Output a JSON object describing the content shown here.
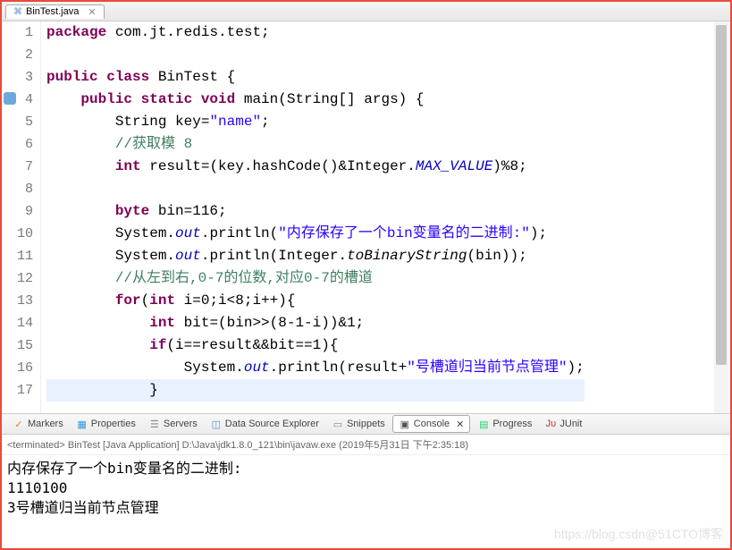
{
  "tab": {
    "label": "BinTest.java"
  },
  "lines": [
    {
      "n": "1",
      "html": "<span class='kw'>package</span> com.jt.redis.test;"
    },
    {
      "n": "2",
      "html": ""
    },
    {
      "n": "3",
      "html": "<span class='kw'>public class</span> BinTest {"
    },
    {
      "n": "4",
      "exec": true,
      "html": "    <span class='kw'>public static void</span> main(String[] args) {"
    },
    {
      "n": "5",
      "html": "        String key=<span class='str'>\"name\"</span>;"
    },
    {
      "n": "6",
      "html": "        <span class='cm'>//获取模 8</span>"
    },
    {
      "n": "7",
      "html": "        <span class='kw'>int</span> result=(key.hashCode()&Integer.<span class='fld'>MAX_VALUE</span>)%8;"
    },
    {
      "n": "8",
      "html": ""
    },
    {
      "n": "9",
      "html": "        <span class='kw'>byte</span> bin=116;"
    },
    {
      "n": "10",
      "html": "        System.<span class='fld'>out</span>.println(<span class='str'>\"内存保存了一个bin变量名的二进制:\"</span>);"
    },
    {
      "n": "11",
      "html": "        System.<span class='fld'>out</span>.println(Integer.<span class='mtd'>toBinaryString</span>(bin));"
    },
    {
      "n": "12",
      "html": "        <span class='cm'>//从左到右,0-7的位数,对应0-7的槽道</span>"
    },
    {
      "n": "13",
      "html": "        <span class='kw'>for</span>(<span class='kw'>int</span> i=0;i&lt;8;i++){"
    },
    {
      "n": "14",
      "html": "            <span class='kw'>int</span> bit=(bin&gt;&gt;(8-1-i))&amp;1;"
    },
    {
      "n": "15",
      "html": "            <span class='kw'>if</span>(i==result&amp;&amp;bit==1){"
    },
    {
      "n": "16",
      "html": "                System.<span class='fld'>out</span>.println(result+<span class='str'>\"号槽道归当前节点管理\"</span>);"
    },
    {
      "n": "17",
      "html": "            }",
      "highlight": true
    }
  ],
  "bottom_tabs": [
    {
      "label": "Markers",
      "icon": "✓",
      "color": "#e67e22"
    },
    {
      "label": "Properties",
      "icon": "▦",
      "color": "#3498db"
    },
    {
      "label": "Servers",
      "icon": "☰",
      "color": "#888"
    },
    {
      "label": "Data Source Explorer",
      "icon": "◫",
      "color": "#5b8fd6"
    },
    {
      "label": "Snippets",
      "icon": "▭",
      "color": "#888"
    },
    {
      "label": "Console",
      "icon": "▣",
      "color": "#555",
      "active": true
    },
    {
      "label": "Progress",
      "icon": "▤",
      "color": "#2ecc71"
    },
    {
      "label": "JUnit",
      "icon": "Jυ",
      "color": "#c0392b"
    }
  ],
  "console": {
    "header": "<terminated> BinTest [Java Application] D:\\Java\\jdk1.8.0_121\\bin\\javaw.exe (2019年5月31日 下午2:35:18)",
    "lines": [
      "内存保存了一个bin变量名的二进制:",
      "1110100",
      "3号槽道归当前节点管理"
    ]
  },
  "watermark": "https://blog.csdn@51CTO博客"
}
